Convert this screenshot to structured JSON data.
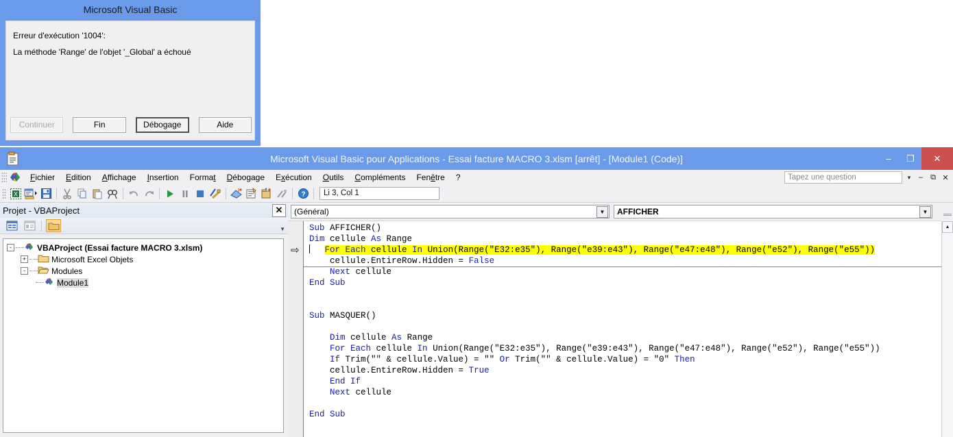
{
  "error_dialog": {
    "title": "Microsoft Visual Basic",
    "message_line1": "Erreur d'exécution '1004':",
    "message_line2": "La méthode 'Range' de l'objet '_Global' a échoué",
    "buttons": [
      {
        "label": "Continuer",
        "state": "disabled"
      },
      {
        "label": "Fin",
        "state": "enabled"
      },
      {
        "label": "Débogage",
        "state": "default"
      },
      {
        "label": "Aide",
        "state": "enabled"
      }
    ]
  },
  "vbe": {
    "title": "Microsoft Visual Basic pour Applications - Essai facture MACRO 3.xlsm [arrêt] - [Module1 (Code)]",
    "app_icon": "vba-document-icon",
    "window_buttons": [
      {
        "name": "minimize",
        "glyph": "–"
      },
      {
        "name": "maximize",
        "glyph": "❐"
      },
      {
        "name": "close",
        "glyph": "✕"
      }
    ],
    "menu": [
      {
        "label": "Fichier",
        "accel": "F"
      },
      {
        "label": "Edition",
        "accel": "E"
      },
      {
        "label": "Affichage",
        "accel": "A"
      },
      {
        "label": "Insertion",
        "accel": "I"
      },
      {
        "label": "Format",
        "accel": "t"
      },
      {
        "label": "Débogage",
        "accel": "D"
      },
      {
        "label": "Exécution",
        "accel": "x"
      },
      {
        "label": "Outils",
        "accel": "O"
      },
      {
        "label": "Compléments",
        "accel": "C"
      },
      {
        "label": "Fenêtre",
        "accel": "ê"
      },
      {
        "label": "?",
        "accel": ""
      }
    ],
    "question_box": {
      "placeholder": "Tapez une question",
      "value": ""
    },
    "mdi_buttons": [
      {
        "name": "mdi-minimize",
        "glyph": "–"
      },
      {
        "name": "mdi-restore",
        "glyph": "❐"
      },
      {
        "name": "mdi-close",
        "glyph": "✕"
      }
    ],
    "toolbar": {
      "position_indicator": "Li 3, Col 1",
      "buttons": [
        "view-excel-icon",
        "insert-userform-icon",
        "save-icon",
        "cut-icon",
        "copy-icon",
        "paste-icon",
        "find-icon",
        "undo-icon",
        "redo-icon",
        "run-icon",
        "break-icon",
        "reset-icon",
        "design-mode-icon",
        "project-explorer-icon",
        "properties-window-icon",
        "object-browser-icon",
        "toolbox-icon",
        "help-icon"
      ]
    },
    "project_explorer": {
      "title": "Projet - VBAProject",
      "close_glyph": "✕",
      "toolbar_buttons": [
        {
          "name": "view-code-icon",
          "active": false
        },
        {
          "name": "view-object-icon",
          "active": false
        },
        {
          "name": "toggle-folders-icon",
          "active": true
        }
      ],
      "overflow_glyph": "▾",
      "tree": [
        {
          "depth": 0,
          "expander": "-",
          "icon": "vbaproject-icon",
          "label": "VBAProject (Essai facture MACRO 3.xlsm)",
          "bold": true,
          "selected": false
        },
        {
          "depth": 1,
          "expander": "+",
          "icon": "folder-icon",
          "label": "Microsoft Excel Objets",
          "bold": false,
          "selected": false
        },
        {
          "depth": 1,
          "expander": "-",
          "icon": "folder-open-icon",
          "label": "Modules",
          "bold": false,
          "selected": false
        },
        {
          "depth": 2,
          "expander": "",
          "icon": "module-icon",
          "label": "Module1",
          "bold": false,
          "selected": true
        }
      ]
    },
    "code_window": {
      "object_dropdown": {
        "value": "(Général)",
        "arrow": "▾"
      },
      "procedure_dropdown": {
        "value": "AFFICHER",
        "arrow": "▾"
      },
      "execution_marker": "⇨",
      "scroll_up_glyph": "▲",
      "lines": [
        {
          "n": 1,
          "indent": 0,
          "tokens": [
            {
              "t": "Sub ",
              "kw": true
            },
            {
              "t": "AFFICHER()",
              "kw": false
            }
          ],
          "highlight": false,
          "caret": false
        },
        {
          "n": 2,
          "indent": 0,
          "tokens": [
            {
              "t": "Dim ",
              "kw": true
            },
            {
              "t": "cellule ",
              "kw": false
            },
            {
              "t": "As ",
              "kw": true
            },
            {
              "t": "Range",
              "kw": false
            }
          ],
          "highlight": false,
          "caret": false
        },
        {
          "n": 3,
          "indent": 4,
          "tokens": [
            {
              "t": "For Each ",
              "kw": true
            },
            {
              "t": "cellule ",
              "kw": false
            },
            {
              "t": "In ",
              "kw": true
            },
            {
              "t": "Union(Range(\"E32:e35\"), Range(\"e39:e43\"), Range(\"e47:e48\"), Range(\"e52\"), Range(\"e55\"))",
              "kw": false
            }
          ],
          "highlight": true,
          "caret": true
        },
        {
          "n": 4,
          "indent": 4,
          "tokens": [
            {
              "t": "cellule.EntireRow.Hidden = ",
              "kw": false
            },
            {
              "t": "False",
              "kw": true
            }
          ],
          "highlight": false,
          "caret": false
        },
        {
          "n": 5,
          "indent": 4,
          "tokens": [
            {
              "t": "Next ",
              "kw": true
            },
            {
              "t": "cellule",
              "kw": false
            }
          ],
          "highlight": false,
          "caret": false
        },
        {
          "n": 6,
          "indent": 0,
          "tokens": [
            {
              "t": "End Sub",
              "kw": true
            }
          ],
          "highlight": false,
          "caret": false
        },
        {
          "n": 7,
          "indent": 0,
          "tokens": [
            {
              "t": "",
              "kw": false
            }
          ],
          "highlight": false,
          "caret": false
        },
        {
          "n": 8,
          "indent": 0,
          "tokens": [
            {
              "t": "",
              "kw": false
            }
          ],
          "highlight": false,
          "caret": false
        },
        {
          "n": 9,
          "indent": 0,
          "tokens": [
            {
              "t": "Sub ",
              "kw": true
            },
            {
              "t": "MASQUER()",
              "kw": false
            }
          ],
          "highlight": false,
          "caret": false
        },
        {
          "n": 10,
          "indent": 0,
          "tokens": [
            {
              "t": "",
              "kw": false
            }
          ],
          "highlight": false,
          "caret": false
        },
        {
          "n": 11,
          "indent": 4,
          "tokens": [
            {
              "t": "Dim ",
              "kw": true
            },
            {
              "t": "cellule ",
              "kw": false
            },
            {
              "t": "As ",
              "kw": true
            },
            {
              "t": "Range",
              "kw": false
            }
          ],
          "highlight": false,
          "caret": false
        },
        {
          "n": 12,
          "indent": 4,
          "tokens": [
            {
              "t": "For Each ",
              "kw": true
            },
            {
              "t": "cellule ",
              "kw": false
            },
            {
              "t": "In ",
              "kw": true
            },
            {
              "t": "Union(Range(\"E32:e35\"), Range(\"e39:e43\"), Range(\"e47:e48\"), Range(\"e52\"), Range(\"e55\"))",
              "kw": false
            }
          ],
          "highlight": false,
          "caret": false
        },
        {
          "n": 13,
          "indent": 4,
          "tokens": [
            {
              "t": "If ",
              "kw": true
            },
            {
              "t": "Trim(\"\" & cellule.Value) = \"\" ",
              "kw": false
            },
            {
              "t": "Or ",
              "kw": true
            },
            {
              "t": "Trim(\"\" & cellule.Value) = \"0\" ",
              "kw": false
            },
            {
              "t": "Then",
              "kw": true
            }
          ],
          "highlight": false,
          "caret": false
        },
        {
          "n": 14,
          "indent": 4,
          "tokens": [
            {
              "t": "cellule.EntireRow.Hidden = ",
              "kw": false
            },
            {
              "t": "True",
              "kw": true
            }
          ],
          "highlight": false,
          "caret": false
        },
        {
          "n": 15,
          "indent": 4,
          "tokens": [
            {
              "t": "End If",
              "kw": true
            }
          ],
          "highlight": false,
          "caret": false
        },
        {
          "n": 16,
          "indent": 4,
          "tokens": [
            {
              "t": "Next ",
              "kw": true
            },
            {
              "t": "cellule",
              "kw": false
            }
          ],
          "highlight": false,
          "caret": false
        },
        {
          "n": 17,
          "indent": 0,
          "tokens": [
            {
              "t": "",
              "kw": false
            }
          ],
          "highlight": false,
          "caret": false
        },
        {
          "n": 18,
          "indent": 0,
          "tokens": [
            {
              "t": "End Sub",
              "kw": true
            }
          ],
          "highlight": false,
          "caret": false
        }
      ]
    }
  },
  "colors": {
    "title_bar_blue": "#6a9bea",
    "close_button_red": "#cc5050",
    "highlight_yellow": "#ffff00",
    "keyword_blue": "#1b1bb0",
    "chrome_gray": "#f0f0f3"
  }
}
